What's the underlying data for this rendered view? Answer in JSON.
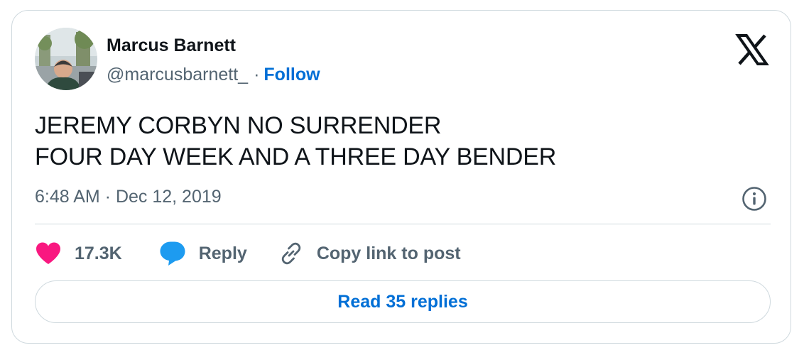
{
  "author": {
    "name": "Marcus Barnett",
    "handle": "@marcusbarnett_",
    "separator": "·",
    "follow_label": "Follow"
  },
  "tweet": {
    "lines": [
      "JEREMY CORBYN NO SURRENDER",
      "FOUR DAY WEEK AND A THREE DAY BENDER"
    ],
    "timestamp": "6:48 AM · Dec 12, 2019"
  },
  "actions": {
    "like_count": "17.3K",
    "reply_label": "Reply",
    "copy_link_label": "Copy link to post"
  },
  "footer": {
    "read_replies_label": "Read 35 replies"
  },
  "icons": {
    "logo": "x-logo-icon",
    "info": "info-icon",
    "like": "heart-icon",
    "reply": "speech-bubble-icon",
    "copy_link": "link-icon"
  },
  "colors": {
    "link_blue": "#006fd6",
    "heart_pink": "#f91880",
    "reply_blue": "#1d9bf0",
    "text_primary": "#0f1419",
    "text_secondary": "#536471",
    "border": "#cfd9de"
  }
}
